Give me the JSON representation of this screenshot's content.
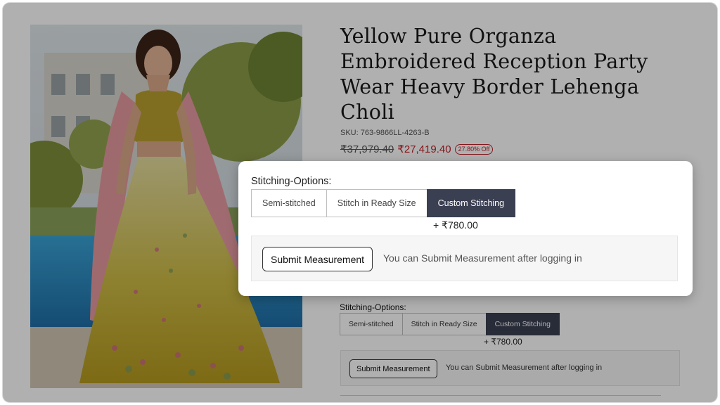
{
  "product": {
    "title": "Yellow Pure Organza Embroidered Reception Party Wear Heavy Border Lehenga Choli",
    "sku": "SKU: 763-9866LL-4263-B",
    "price_old": "₹37,979.40",
    "price_new": "₹27,419.40",
    "discount": "27.80% Off",
    "image_alt": "Model wearing yellow embroidered lehenga with pink dupatta"
  },
  "stitching": {
    "label": "Stitching-Options:",
    "options": [
      "Semi-stitched",
      "Stitch in Ready Size",
      "Custom Stitching"
    ],
    "selected": "Custom Stitching",
    "extra_price": "+ ₹780.00",
    "submit_label": "Submit Measurement",
    "login_note": "You can Submit Measurement after logging in"
  },
  "colors": {
    "selected_option_bg": "#3b3f52",
    "sale_price": "#c0222b"
  }
}
